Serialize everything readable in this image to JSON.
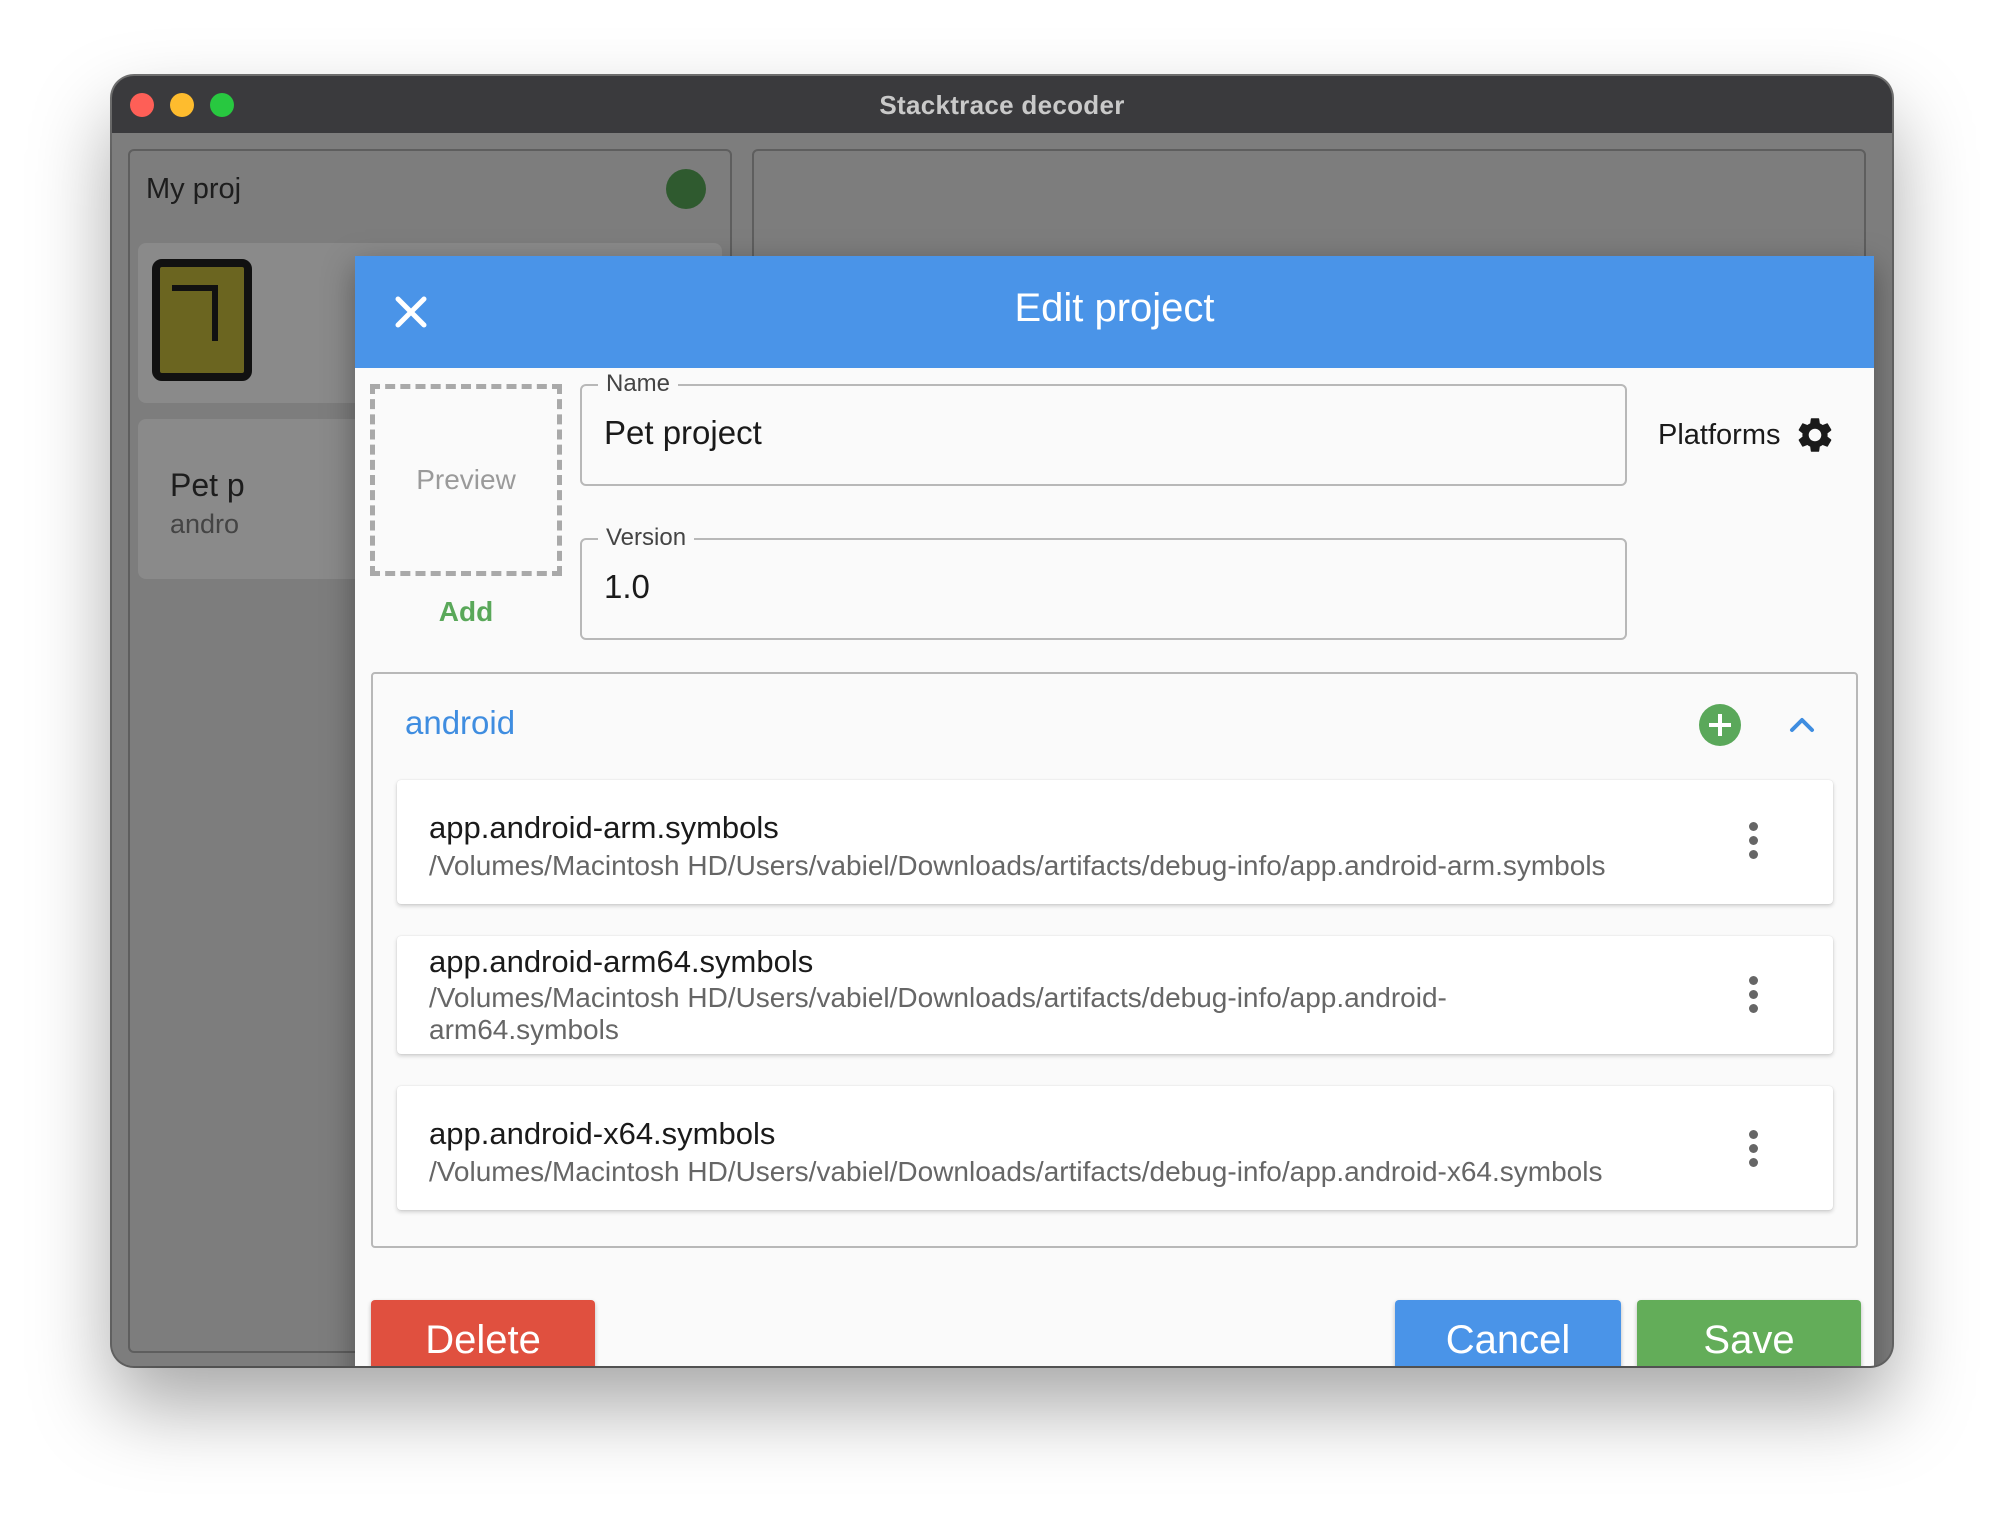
{
  "window": {
    "title": "Stacktrace decoder"
  },
  "background_app": {
    "left_header": "My proj",
    "card_title": "Pet p",
    "card_subtitle": "andro"
  },
  "dialog": {
    "title": "Edit project",
    "preview_label": "Preview",
    "add_label": "Add",
    "name_field": {
      "label": "Name",
      "value": "Pet project"
    },
    "version_field": {
      "label": "Version",
      "value": "1.0"
    },
    "platforms_label": "Platforms",
    "platform": {
      "name": "android",
      "symbols": [
        {
          "title": "app.android-arm.symbols",
          "path": "/Volumes/Macintosh HD/Users/vabiel/Downloads/artifacts/debug-info/app.android-arm.symbols"
        },
        {
          "title": "app.android-arm64.symbols",
          "path": "/Volumes/Macintosh HD/Users/vabiel/Downloads/artifacts/debug-info/app.android-arm64.symbols"
        },
        {
          "title": "app.android-x64.symbols",
          "path": "/Volumes/Macintosh HD/Users/vabiel/Downloads/artifacts/debug-info/app.android-x64.symbols"
        }
      ]
    },
    "buttons": {
      "delete": "Delete",
      "cancel": "Cancel",
      "save": "Save"
    }
  },
  "colors": {
    "header": "#4a94e8",
    "delete": "#e0503f",
    "cancel": "#4a94e8",
    "save": "#63ad59",
    "add_accent": "#5aa85a",
    "platform_name": "#3f8de0"
  },
  "icons": [
    "close-icon",
    "gear-icon",
    "add-circle-icon",
    "chevron-up-icon",
    "more-vertical-icon"
  ]
}
